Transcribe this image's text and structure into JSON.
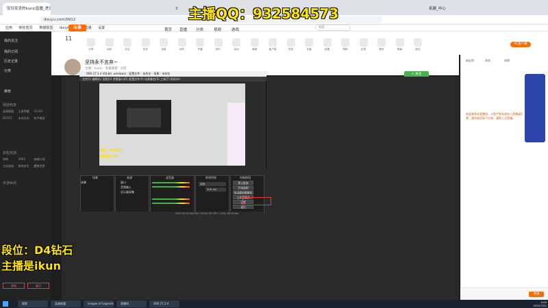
{
  "browser": {
    "tabs": [
      {
        "label": "安玲安灵的kunzi直播_虎牙直播"
      },
      {
        "label": "3"
      },
      {
        "label": "拓展_中心"
      }
    ],
    "url": "douyu.com/9912",
    "bookmarks": [
      "应用",
      "新标签页",
      "英雄联盟",
      "douyu 斗鱼",
      "直播",
      "设置"
    ]
  },
  "overlay": {
    "qq": "主播QQ：932584573",
    "rank": "段位：D4钻石",
    "streamer": "主播是ikun",
    "small_rank": "段位：D4钻石",
    "small_streamer": "主播是ikun"
  },
  "site": {
    "logo": "斗鱼",
    "nav": [
      "首页",
      "直播",
      "分类",
      "视频",
      "游戏",
      "鱼吧"
    ],
    "search_placeholder": "搜索",
    "header_icons": [
      "分类",
      "动态",
      "关注",
      "历史",
      "消息",
      "创作",
      "开播",
      "排行",
      "活动",
      "商城",
      "客户端",
      "任务",
      "充值",
      "设置",
      "帮助",
      "反馈",
      "更多",
      "等级",
      "粉丝",
      "PC客户端"
    ],
    "room_title": "坚持永不言弃~",
    "room_meta": "主播：kunzi · 英雄联盟 · 分区",
    "follow": "+ 关注",
    "count": "11",
    "pc_client": "PC客户端"
  },
  "leftnav": {
    "items": [
      "我的关注",
      "我的订阅",
      "历史记录",
      "分类",
      "推荐",
      "游戏",
      "娱乐"
    ],
    "sections": [
      "网游竞技",
      "单机热游",
      "手游休闲"
    ],
    "grid": [
      "英雄联盟",
      "王者荣耀",
      "CS:GO",
      "DOTA2",
      "永劫无间",
      "和平精英",
      "原神",
      "APEX",
      "穿越火线",
      "主机游戏",
      "绝地求生",
      "魔兽世界"
    ]
  },
  "obs": {
    "title": "OBS 27.2.4 (64-bit, windows) - 配置文件：未命名 - 场景：未命名",
    "menu": "文件(F)  编辑(E)  视图(V)  停靠窗口(D)  配置文件(P)  场景集合(S)  工具(T)  帮助(H)",
    "scenes_header": "场景",
    "sources_header": "来源",
    "mixer_header": "混音器",
    "transitions_header": "转场特效",
    "controls_header": "控制按钮",
    "scene_item": "场景",
    "source_items": [
      "窗口",
      "音频输入",
      "显示器采集"
    ],
    "transition": "淡出",
    "duration": "300 ms",
    "controls": [
      "停止推流",
      "开始录制",
      "启动虚拟摄像机",
      "工作室模式",
      "设置",
      "退出"
    ],
    "status": "LIVE: 00:00:00   REC: 00:00:00   CPU: 2.4%, 60.00 fps"
  },
  "chat": {
    "tabs": [
      "粉丝榜",
      "贵宾",
      "周榜"
    ],
    "notice": "欢迎来到本直播间，斗鱼严禁未成年人直播或打赏，请勿轻信私下交易，谨防上当受骗。",
    "send": "发送"
  },
  "taskbar": {
    "items": [
      "搜索",
      "英雄联盟",
      "League of Legends",
      "直播间",
      "OBS 27.2.4"
    ],
    "time": "0:00",
    "date": "2022/7/22"
  }
}
